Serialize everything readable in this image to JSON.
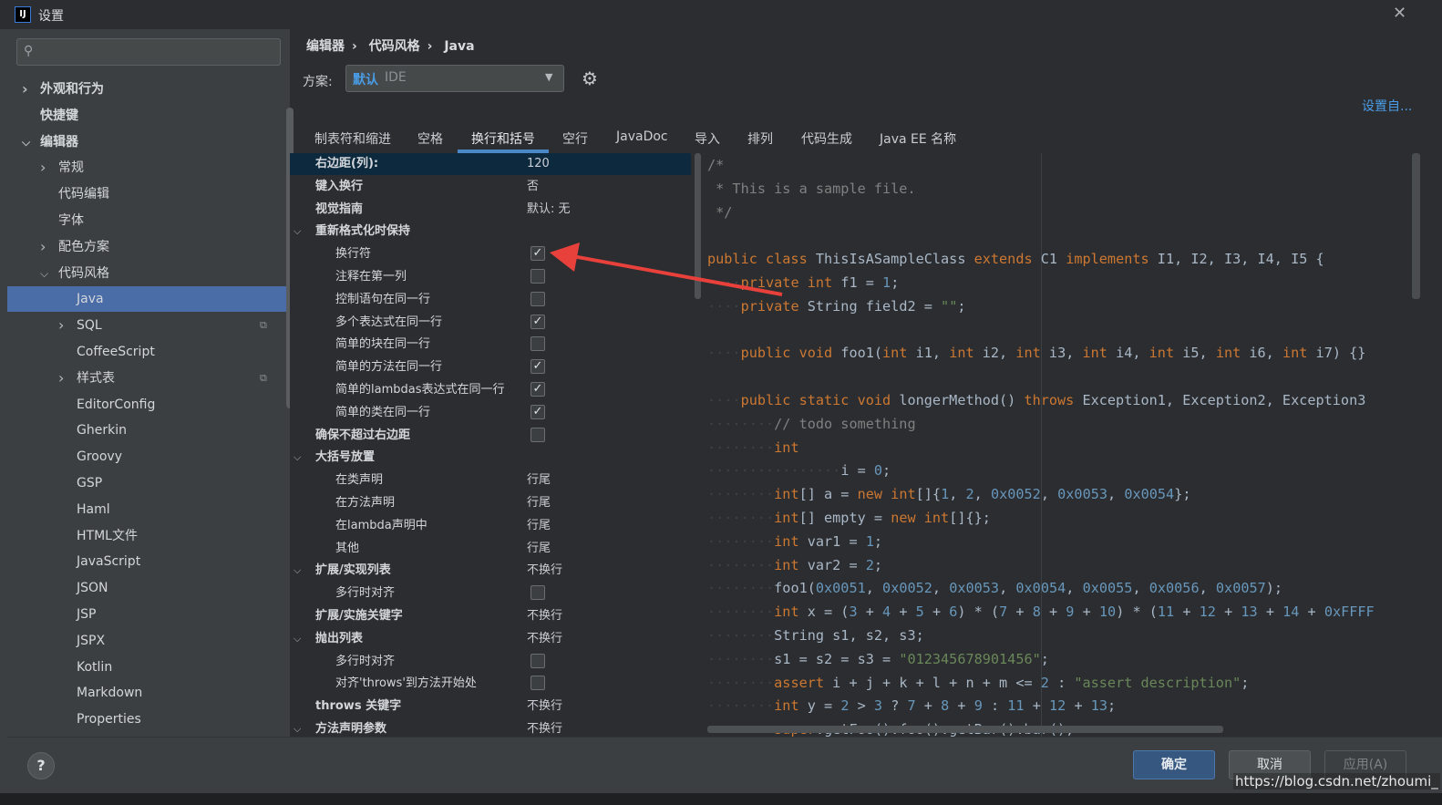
{
  "window": {
    "title": "设置",
    "icon": "intellij-logo-icon"
  },
  "sidebar": {
    "search_placeholder": "",
    "items": [
      {
        "label": "外观和行为",
        "expandable": true,
        "expanded": false,
        "level": 0
      },
      {
        "label": "快捷键",
        "expandable": false,
        "level": 0
      },
      {
        "label": "编辑器",
        "expandable": true,
        "expanded": true,
        "level": 0
      },
      {
        "label": "常规",
        "expandable": true,
        "expanded": false,
        "level": 1
      },
      {
        "label": "代码编辑",
        "expandable": false,
        "level": 1
      },
      {
        "label": "字体",
        "expandable": false,
        "level": 1
      },
      {
        "label": "配色方案",
        "expandable": true,
        "expanded": false,
        "level": 1
      },
      {
        "label": "代码风格",
        "expandable": true,
        "expanded": true,
        "level": 1
      },
      {
        "label": "Java",
        "selected": true,
        "level": 2
      },
      {
        "label": "SQL",
        "expandable": true,
        "level": 2,
        "copy_icon": true
      },
      {
        "label": "CoffeeScript",
        "level": 2
      },
      {
        "label": "样式表",
        "expandable": true,
        "level": 2,
        "copy_icon": true
      },
      {
        "label": "EditorConfig",
        "level": 2
      },
      {
        "label": "Gherkin",
        "level": 2
      },
      {
        "label": "Groovy",
        "level": 2
      },
      {
        "label": "GSP",
        "level": 2
      },
      {
        "label": "Haml",
        "level": 2
      },
      {
        "label": "HTML文件",
        "level": 2
      },
      {
        "label": "JavaScript",
        "level": 2
      },
      {
        "label": "JSON",
        "level": 2
      },
      {
        "label": "JSP",
        "level": 2
      },
      {
        "label": "JSPX",
        "level": 2
      },
      {
        "label": "Kotlin",
        "level": 2
      },
      {
        "label": "Markdown",
        "level": 2
      },
      {
        "label": "Properties",
        "level": 2
      }
    ]
  },
  "breadcrumb": [
    "编辑器",
    "代码风格",
    "Java"
  ],
  "scheme": {
    "label": "方案:",
    "value": "默认",
    "sub": "IDE"
  },
  "set_from": "设置自...",
  "tabs": [
    "制表符和缩进",
    "空格",
    "换行和括号",
    "空行",
    "JavaDoc",
    "导入",
    "排列",
    "代码生成",
    "Java EE 名称"
  ],
  "active_tab": "换行和括号",
  "options": [
    {
      "name": "右边距(列):",
      "value": "120",
      "bold": true,
      "highlight": true,
      "indent": 0
    },
    {
      "name": "键入换行",
      "value": "否",
      "bold": true,
      "indent": 0
    },
    {
      "name": "视觉指南",
      "value": "默认: 无",
      "bold": true,
      "indent": 0
    },
    {
      "name": "重新格式化时保持",
      "bold": true,
      "group": true,
      "indent": 0
    },
    {
      "name": "换行符",
      "checkbox": true,
      "checked": true,
      "indent": 1
    },
    {
      "name": "注释在第一列",
      "checkbox": true,
      "checked": false,
      "indent": 1
    },
    {
      "name": "控制语句在同一行",
      "checkbox": true,
      "checked": false,
      "indent": 1
    },
    {
      "name": "多个表达式在同一行",
      "checkbox": true,
      "checked": true,
      "indent": 1
    },
    {
      "name": "简单的块在同一行",
      "checkbox": true,
      "checked": false,
      "indent": 1
    },
    {
      "name": "简单的方法在同一行",
      "checkbox": true,
      "checked": true,
      "indent": 1
    },
    {
      "name": "简单的lambdas表达式在同一行",
      "checkbox": true,
      "checked": true,
      "indent": 1
    },
    {
      "name": "简单的类在同一行",
      "checkbox": true,
      "checked": true,
      "indent": 1
    },
    {
      "name": "确保不超过右边距",
      "bold": true,
      "checkbox": true,
      "checked": false,
      "indent": 0
    },
    {
      "name": "大括号放置",
      "bold": true,
      "group": true,
      "indent": 0
    },
    {
      "name": "在类声明",
      "value": "行尾",
      "indent": 1
    },
    {
      "name": "在方法声明",
      "value": "行尾",
      "indent": 1
    },
    {
      "name": "在lambda声明中",
      "value": "行尾",
      "indent": 1
    },
    {
      "name": "其他",
      "value": "行尾",
      "indent": 1
    },
    {
      "name": "扩展/实现列表",
      "value": "不换行",
      "bold": true,
      "group": true,
      "indent": 0
    },
    {
      "name": "多行时对齐",
      "checkbox": true,
      "checked": false,
      "indent": 1
    },
    {
      "name": "扩展/实施关键字",
      "value": "不换行",
      "bold": true,
      "indent": 0
    },
    {
      "name": "抛出列表",
      "value": "不换行",
      "bold": true,
      "group": true,
      "indent": 0
    },
    {
      "name": "多行时对齐",
      "checkbox": true,
      "checked": false,
      "indent": 1
    },
    {
      "name": "对齐'throws'到方法开始处",
      "checkbox": true,
      "checked": false,
      "indent": 1
    },
    {
      "name": "throws 关键字",
      "value": "不换行",
      "bold": true,
      "indent": 0
    },
    {
      "name": "方法声明参数",
      "value": "不换行",
      "bold": true,
      "group": true,
      "indent": 0
    }
  ],
  "code_lines": [
    [
      [
        "com",
        "/*"
      ]
    ],
    [
      [
        "com",
        " * This is a sample file."
      ]
    ],
    [
      [
        "com",
        " */"
      ]
    ],
    [],
    [
      [
        "kw",
        "public class "
      ],
      [
        "",
        "ThisIsASampleClass "
      ],
      [
        "kw",
        "extends "
      ],
      [
        "",
        "C1 "
      ],
      [
        "kw",
        "implements "
      ],
      [
        "",
        "I1, I2, I3, I4, I5 {"
      ]
    ],
    [
      [
        "dot",
        "····"
      ],
      [
        "kw",
        "private int "
      ],
      [
        "",
        "f1 = "
      ],
      [
        "num",
        "1"
      ],
      [
        "",
        ";"
      ]
    ],
    [
      [
        "dot",
        "····"
      ],
      [
        "kw",
        "private "
      ],
      [
        "",
        "String field2 = "
      ],
      [
        "str",
        "\"\""
      ],
      [
        "",
        ";"
      ]
    ],
    [],
    [
      [
        "dot",
        "····"
      ],
      [
        "kw",
        "public void "
      ],
      [
        "",
        "foo1("
      ],
      [
        "kw",
        "int "
      ],
      [
        "",
        "i1, "
      ],
      [
        "kw",
        "int "
      ],
      [
        "",
        "i2, "
      ],
      [
        "kw",
        "int "
      ],
      [
        "",
        "i3, "
      ],
      [
        "kw",
        "int "
      ],
      [
        "",
        "i4, "
      ],
      [
        "kw",
        "int "
      ],
      [
        "",
        "i5, "
      ],
      [
        "kw",
        "int "
      ],
      [
        "",
        "i6, "
      ],
      [
        "kw",
        "int "
      ],
      [
        "",
        "i7) {}"
      ]
    ],
    [],
    [
      [
        "dot",
        "····"
      ],
      [
        "kw",
        "public static void "
      ],
      [
        "",
        "longerMethod() "
      ],
      [
        "kw",
        "throws "
      ],
      [
        "",
        "Exception1, Exception2, Exception3"
      ]
    ],
    [
      [
        "dot",
        "········"
      ],
      [
        "com",
        "// todo something"
      ]
    ],
    [
      [
        "dot",
        "········"
      ],
      [
        "kw",
        "int"
      ]
    ],
    [
      [
        "dot",
        "················"
      ],
      [
        "",
        "i = "
      ],
      [
        "num",
        "0"
      ],
      [
        "",
        ";"
      ]
    ],
    [
      [
        "dot",
        "········"
      ],
      [
        "kw",
        "int"
      ],
      [
        "",
        "[] a = "
      ],
      [
        "kw",
        "new int"
      ],
      [
        "",
        "[]{"
      ],
      [
        "num",
        "1"
      ],
      [
        "",
        ", "
      ],
      [
        "num",
        "2"
      ],
      [
        "",
        ", "
      ],
      [
        "num",
        "0x0052"
      ],
      [
        "",
        ", "
      ],
      [
        "num",
        "0x0053"
      ],
      [
        "",
        ", "
      ],
      [
        "num",
        "0x0054"
      ],
      [
        "",
        "};"
      ]
    ],
    [
      [
        "dot",
        "········"
      ],
      [
        "kw",
        "int"
      ],
      [
        "",
        "[] empty = "
      ],
      [
        "kw",
        "new int"
      ],
      [
        "",
        "[]{};"
      ]
    ],
    [
      [
        "dot",
        "········"
      ],
      [
        "kw",
        "int "
      ],
      [
        "",
        "var1 = "
      ],
      [
        "num",
        "1"
      ],
      [
        "",
        ";"
      ]
    ],
    [
      [
        "dot",
        "········"
      ],
      [
        "kw",
        "int "
      ],
      [
        "",
        "var2 = "
      ],
      [
        "num",
        "2"
      ],
      [
        "",
        ";"
      ]
    ],
    [
      [
        "dot",
        "········"
      ],
      [
        "",
        "foo1("
      ],
      [
        "num",
        "0x0051"
      ],
      [
        "",
        ", "
      ],
      [
        "num",
        "0x0052"
      ],
      [
        "",
        ", "
      ],
      [
        "num",
        "0x0053"
      ],
      [
        "",
        ", "
      ],
      [
        "num",
        "0x0054"
      ],
      [
        "",
        ", "
      ],
      [
        "num",
        "0x0055"
      ],
      [
        "",
        ", "
      ],
      [
        "num",
        "0x0056"
      ],
      [
        "",
        ", "
      ],
      [
        "num",
        "0x0057"
      ],
      [
        "",
        ");"
      ]
    ],
    [
      [
        "dot",
        "········"
      ],
      [
        "kw",
        "int "
      ],
      [
        "",
        "x = ("
      ],
      [
        "num",
        "3"
      ],
      [
        "",
        " + "
      ],
      [
        "num",
        "4"
      ],
      [
        "",
        " + "
      ],
      [
        "num",
        "5"
      ],
      [
        "",
        " + "
      ],
      [
        "num",
        "6"
      ],
      [
        "",
        ") * ("
      ],
      [
        "num",
        "7"
      ],
      [
        "",
        " + "
      ],
      [
        "num",
        "8"
      ],
      [
        "",
        " + "
      ],
      [
        "num",
        "9"
      ],
      [
        "",
        " + "
      ],
      [
        "num",
        "10"
      ],
      [
        "",
        ") * ("
      ],
      [
        "num",
        "11"
      ],
      [
        "",
        " + "
      ],
      [
        "num",
        "12"
      ],
      [
        "",
        " + "
      ],
      [
        "num",
        "13"
      ],
      [
        "",
        " + "
      ],
      [
        "num",
        "14"
      ],
      [
        "",
        " + "
      ],
      [
        "num",
        "0xFFFF"
      ]
    ],
    [
      [
        "dot",
        "········"
      ],
      [
        "",
        "String s1, s2, s3;"
      ]
    ],
    [
      [
        "dot",
        "········"
      ],
      [
        "",
        "s1 = s2 = s3 = "
      ],
      [
        "str",
        "\"012345678901456\""
      ],
      [
        "",
        ";"
      ]
    ],
    [
      [
        "dot",
        "········"
      ],
      [
        "kw",
        "assert "
      ],
      [
        "",
        "i + j + k + l + n + m <= "
      ],
      [
        "num",
        "2"
      ],
      [
        "",
        " : "
      ],
      [
        "str",
        "\"assert description\""
      ],
      [
        "",
        ";"
      ]
    ],
    [
      [
        "dot",
        "········"
      ],
      [
        "kw",
        "int "
      ],
      [
        "",
        "y = "
      ],
      [
        "num",
        "2"
      ],
      [
        "",
        " > "
      ],
      [
        "num",
        "3"
      ],
      [
        "",
        " ? "
      ],
      [
        "num",
        "7"
      ],
      [
        "",
        " + "
      ],
      [
        "num",
        "8"
      ],
      [
        "",
        " + "
      ],
      [
        "num",
        "9"
      ],
      [
        "",
        " : "
      ],
      [
        "num",
        "11"
      ],
      [
        "",
        " + "
      ],
      [
        "num",
        "12"
      ],
      [
        "",
        " + "
      ],
      [
        "num",
        "13"
      ],
      [
        "",
        ";"
      ]
    ],
    [
      [
        "dot",
        "········"
      ],
      [
        "kw",
        "super"
      ],
      [
        "",
        ".getFoo().foo().getBar().bar();"
      ]
    ]
  ],
  "footer": {
    "help": "?",
    "ok": "确定",
    "cancel": "取消",
    "apply": "应用(A)"
  },
  "watermark": "https://blog.csdn.net/zhoumi_",
  "colors": {
    "accent": "#4a88c7",
    "selection": "#4a6da7",
    "annotation_arrow": "#e8413b"
  }
}
